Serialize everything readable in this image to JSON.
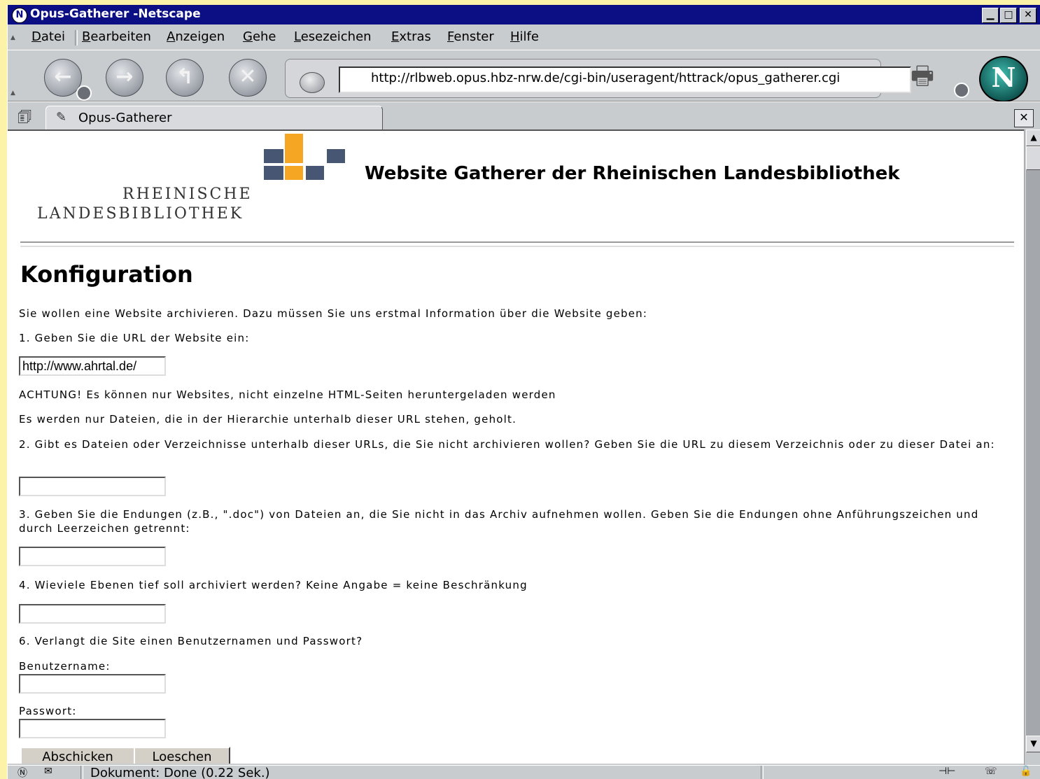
{
  "window": {
    "title": "Opus-Gatherer -Netscape",
    "app_icon": "N",
    "buttons": {
      "minimize": "▁",
      "maximize": "□",
      "close": "✕"
    }
  },
  "menu": [
    "Datei",
    "Bearbeiten",
    "Anzeigen",
    "Gehe",
    "Lesezeichen",
    "Extras",
    "Fenster",
    "Hilfe"
  ],
  "menu_access_keys": [
    "D",
    "B",
    "A",
    "G",
    "L",
    "E",
    "F",
    "H"
  ],
  "nav": {
    "url": "http://rlbweb.opus.hbz-nrw.de/cgi-bin/useragent/httrack/opus_gatherer.cgi",
    "icons": [
      "back-arrow-icon",
      "forward-arrow-icon",
      "reload-icon",
      "stop-icon",
      "print-icon",
      "netscape-logo-icon"
    ]
  },
  "tab": {
    "label": "Opus-Gatherer"
  },
  "page": {
    "logo": {
      "line1": "RHEINISCHE",
      "line2": "LANDESBIBLIOTHEK"
    },
    "site_title": "Website Gatherer der Rheinischen Landesbibliothek",
    "heading": "Konfiguration",
    "intro": "Sie wollen eine Website archivieren. Dazu müssen Sie uns erstmal Information über die Website geben:",
    "q1": "1. Geben Sie die URL der Website ein:",
    "url_value": "http://www.ahrtal.de/",
    "warning": "ACHTUNG! Es können nur Websites, nicht einzelne HTML-Seiten heruntergeladen werden",
    "note": "Es werden nur Dateien, die in der Hierarchie unterhalb dieser URL stehen, geholt.",
    "q2": "2. Gibt es Dateien oder Verzeichnisse unterhalb dieser URLs, die Sie nicht archivieren wollen? Geben Sie die URL zu diesem Verzeichnis oder zu dieser Datei an:",
    "q3": "3. Geben Sie die Endungen (z.B., \".doc\") von Dateien an, die Sie nicht in das Archiv aufnehmen wollen. Geben Sie die Endungen ohne Anführungszeichen und durch Leerzeichen getrennt:",
    "q4": "4. Wieviele Ebenen tief soll archiviert werden? Keine Angabe = keine Beschränkung",
    "q6": "6. Verlangt die Site einen Benutzernamen und Passwort?",
    "username_label": "Benutzername:",
    "password_label": "Passwort:",
    "submit_label": "Abschicken",
    "reset_label": "Loeschen"
  },
  "status": {
    "text": "Dokument: Done (0.22 Sek.)"
  },
  "colors": {
    "titlebar": "#0b0f83",
    "chrome": "#c9cccf",
    "logo_blue": "#475673",
    "logo_orange": "#f5a623",
    "desktop": "#fdf3a8"
  }
}
